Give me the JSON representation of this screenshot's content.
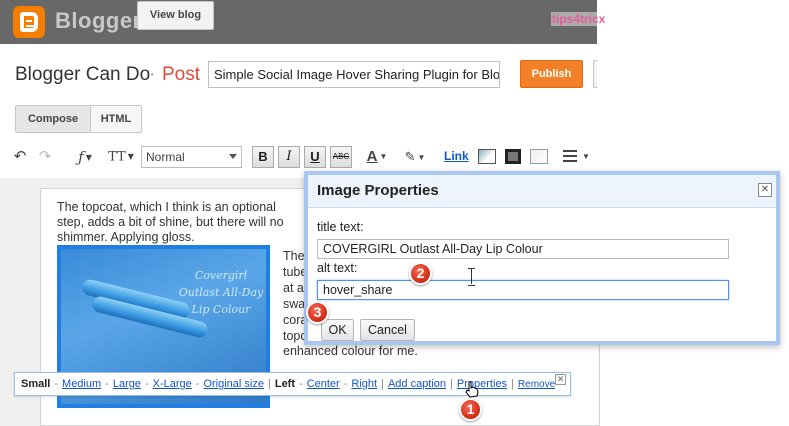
{
  "header": {
    "logo_text": "Blogger",
    "view_blog_label": "View blog",
    "watermark": "tips4tricx"
  },
  "title_row": {
    "blog_name": "Blogger Can Do",
    "separator": "·",
    "section": "Post",
    "post_title_value": "Simple Social Image Hover Sharing Plugin for Blo",
    "publish_label": "Publish"
  },
  "tabs": [
    {
      "label": "Compose"
    },
    {
      "label": "HTML"
    }
  ],
  "toolbar": {
    "font_size_value": "Normal",
    "bold": "B",
    "italic": "I",
    "underline": "U",
    "strike": "ABC",
    "link_label": "Link"
  },
  "editor": {
    "para1": "The topcoat, which I think is an optional step, adds a bit of shine, but there will no shimmer. Applying gloss.",
    "image_caption": "Covergirl Outlast All-Day Lip Colour",
    "para2": "The\ntube\nat a\nswa\ncora\ntopc",
    "para3": "enhanced colour for me."
  },
  "image_bubble": {
    "size_label": "Small",
    "sizes": [
      "Medium",
      "Large",
      "X-Large",
      "Original size"
    ],
    "align_label": "Left",
    "aligns": [
      "Center",
      "Right"
    ],
    "add_caption": "Add caption",
    "properties": "Properties",
    "remove": "Remove"
  },
  "dialog": {
    "title": "Image Properties",
    "close_glyph": "✕",
    "title_text_label": "title text:",
    "title_text_value": "COVERGIRL Outlast All-Day Lip Colour",
    "alt_text_label": "alt text:",
    "alt_text_value": "hover_share",
    "ok_label": "OK",
    "cancel_label": "Cancel"
  },
  "steps": [
    "1",
    "2",
    "3"
  ],
  "colors": {
    "topbar": "#686868",
    "brand_orange": "#f57d00",
    "publish": "#f48028",
    "link_blue": "#1155cc",
    "dialog_border": "#a9c6ee",
    "step_red": "#d8311a"
  }
}
